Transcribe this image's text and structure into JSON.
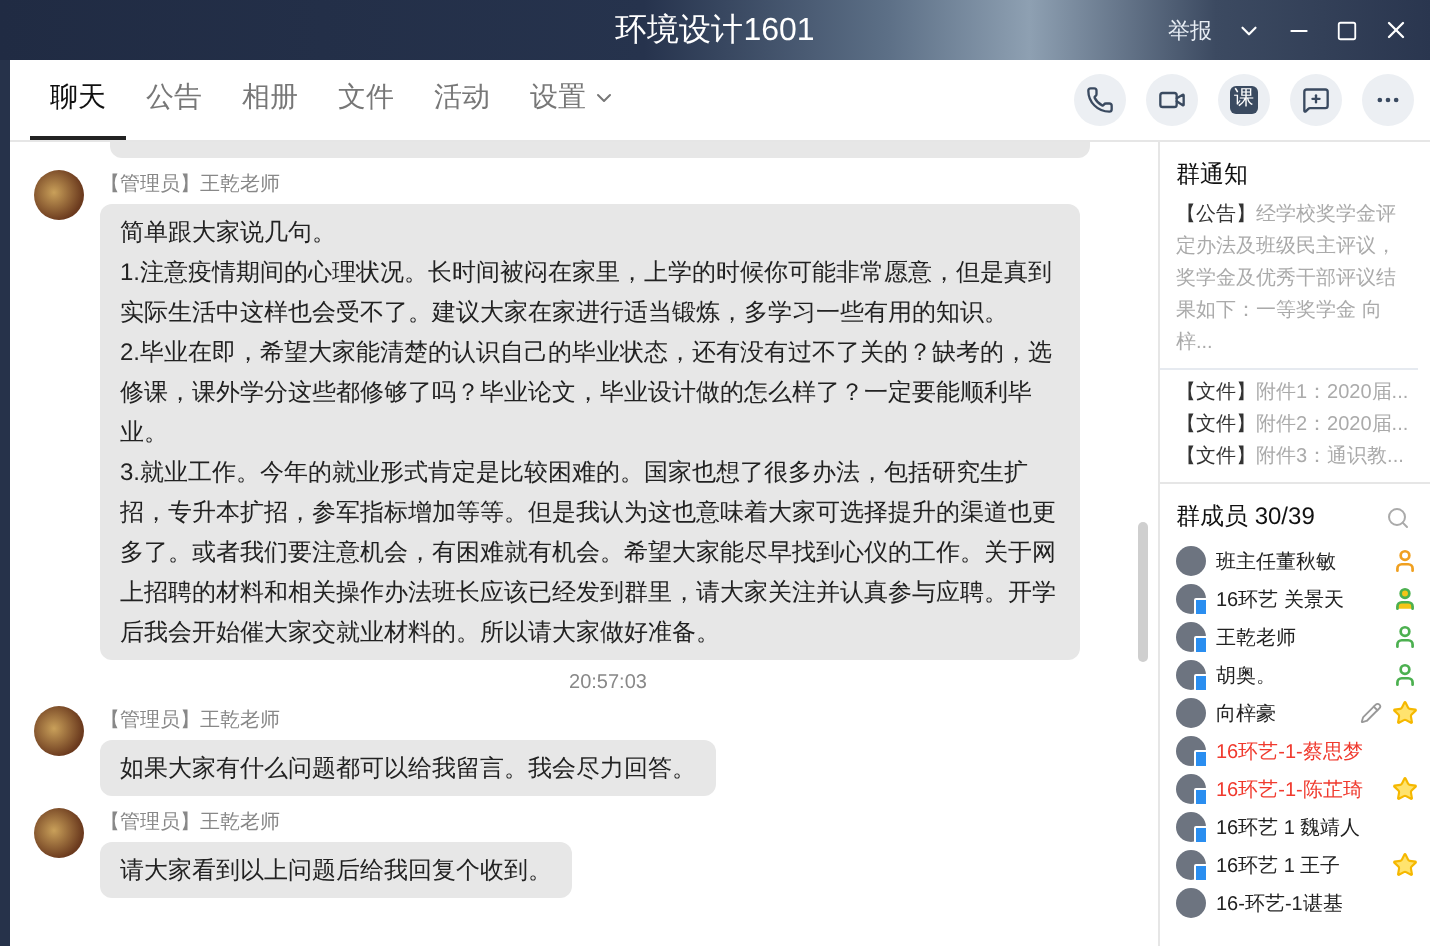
{
  "window": {
    "title": "环境设计1601",
    "report": "举报"
  },
  "tabs": [
    {
      "label": "聊天",
      "selected": true,
      "dropdown": false
    },
    {
      "label": "公告",
      "selected": false,
      "dropdown": false
    },
    {
      "label": "相册",
      "selected": false,
      "dropdown": false
    },
    {
      "label": "文件",
      "selected": false,
      "dropdown": false
    },
    {
      "label": "活动",
      "selected": false,
      "dropdown": false
    },
    {
      "label": "设置",
      "selected": false,
      "dropdown": true
    }
  ],
  "toolbar": [
    {
      "kind": "phone"
    },
    {
      "kind": "video"
    },
    {
      "kind": "text",
      "label": "课"
    },
    {
      "kind": "add-comment"
    },
    {
      "kind": "more"
    }
  ],
  "messages": [
    {
      "kind": "cut"
    },
    {
      "kind": "message",
      "role": "【管理员】",
      "sender": "王乾老师",
      "paragraphs": [
        "简单跟大家说几句。",
        "1.注意疫情期间的心理状况。长时间被闷在家里，上学的时候你可能非常愿意，但是真到实际生活中这样也会受不了。建议大家在家进行适当锻炼，多学习一些有用的知识。",
        "2.毕业在即，希望大家能清楚的认识自己的毕业状态，还有没有过不了关的？缺考的，选修课，课外学分这些都修够了吗？毕业论文，毕业设计做的怎么样了？一定要能顺利毕业。",
        "3.就业工作。今年的就业形式肯定是比较困难的。国家也想了很多办法，包括研究生扩招，专升本扩招，参军指标增加等等。但是我认为这也意味着大家可选择提升的渠道也更多了。或者我们要注意机会，有困难就有机会。希望大家能尽早找到心仪的工作。关于网上招聘的材料和相关操作办法班长应该已经发到群里，请大家关注并认真参与应聘。开学后我会开始催大家交就业材料的。所以请大家做好准备。"
      ]
    },
    {
      "kind": "time",
      "text": "20:57:03"
    },
    {
      "kind": "message",
      "role": "【管理员】",
      "sender": "王乾老师",
      "paragraphs": [
        "如果大家有什么问题都可以给我留言。我会尽力回答。"
      ]
    },
    {
      "kind": "message",
      "role": "【管理员】",
      "sender": "王乾老师",
      "paragraphs": [
        "请大家看到以上问题后给我回复个收到。"
      ]
    }
  ],
  "notice": {
    "title": "群通知",
    "announcement": {
      "tag": "【公告】",
      "text": "经学校奖学金评定办法及班级民主评议，奖学金及优秀干部评议结果如下：一等奖学金 向梓..."
    },
    "files": [
      {
        "tag": "【文件】",
        "name": "附件1：2020届..."
      },
      {
        "tag": "【文件】",
        "name": "附件2：2020届..."
      },
      {
        "tag": "【文件】",
        "name": "附件3：通识教..."
      }
    ]
  },
  "members": {
    "title": "群成员 30/39",
    "items": [
      {
        "name": "班主任董秋敏",
        "highlighted": false,
        "mobile": false,
        "kind": "owner",
        "editable": false
      },
      {
        "name": "16环艺 关景天",
        "highlighted": false,
        "mobile": true,
        "kind": "starred_admin",
        "editable": false
      },
      {
        "name": "王乾老师",
        "highlighted": false,
        "mobile": true,
        "kind": "admin",
        "editable": false
      },
      {
        "name": "胡奥。",
        "highlighted": false,
        "mobile": true,
        "kind": "admin",
        "editable": false
      },
      {
        "name": "向梓豪",
        "highlighted": false,
        "mobile": false,
        "kind": "starred",
        "editable": true
      },
      {
        "name": "16环艺-1-蔡思梦",
        "highlighted": true,
        "mobile": true,
        "kind": "plain",
        "editable": false
      },
      {
        "name": "16环艺-1-陈芷琦",
        "highlighted": true,
        "mobile": true,
        "kind": "starred",
        "editable": false
      },
      {
        "name": "16环艺 1  魏靖人",
        "highlighted": false,
        "mobile": true,
        "kind": "plain",
        "editable": false
      },
      {
        "name": "16环艺 1  王子",
        "highlighted": false,
        "mobile": true,
        "kind": "starred",
        "editable": false
      },
      {
        "name": "16-环艺-1谌基",
        "highlighted": false,
        "mobile": false,
        "kind": "plain",
        "editable": false
      }
    ]
  }
}
